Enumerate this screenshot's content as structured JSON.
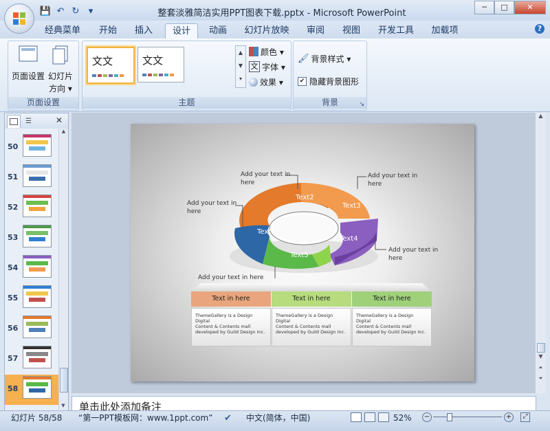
{
  "window": {
    "title": "整套淡雅简洁实用PPT图表下载.pptx - Microsoft PowerPoint",
    "min": "─",
    "max": "□",
    "close": "✕"
  },
  "qat": {
    "save": "💾",
    "undo": "↶",
    "redo": "↻",
    "more": "▾"
  },
  "tabs": [
    "经典菜单",
    "开始",
    "插入",
    "设计",
    "动画",
    "幻灯片放映",
    "审阅",
    "视图",
    "开发工具",
    "加载项"
  ],
  "active_tab": "设计",
  "help": "?",
  "ribbon": {
    "page_setup": {
      "btn1": "页面设置",
      "btn2_line1": "幻灯片",
      "btn2_line2": "方向 ▾",
      "label": "页面设置"
    },
    "themes": {
      "thumb1_text": "文文",
      "thumb2_text": "文文",
      "colors": "颜色 ▾",
      "fonts": "字体 ▾",
      "effects": "效果 ▾",
      "font_glyph": "文",
      "label": "主题"
    },
    "background": {
      "styles": "背景样式 ▾",
      "hide": "隐藏背景图形",
      "label": "背景",
      "launcher": "↘"
    }
  },
  "slides": [
    {
      "num": "50"
    },
    {
      "num": "51"
    },
    {
      "num": "52"
    },
    {
      "num": "53"
    },
    {
      "num": "54"
    },
    {
      "num": "55"
    },
    {
      "num": "56"
    },
    {
      "num": "57"
    },
    {
      "num": "58"
    }
  ],
  "pane_close": "✕",
  "slide_content": {
    "segments": [
      "Text1",
      "Text2",
      "Text3",
      "Text4",
      "Text5"
    ],
    "callouts": {
      "left_line1": "Add your text in",
      "left_line2": "here",
      "top_line1": "Add your text in",
      "top_line2": "here",
      "topright_line1": "Add your text in",
      "topright_line2": "here",
      "right_line1": "Add your text in",
      "right_line2": "here",
      "bottom": "Add your text in here"
    },
    "table": {
      "headers": [
        "Text in here",
        "Text in here",
        "Text in here"
      ],
      "header_colors": [
        "#e9a57d",
        "#b6dc7e",
        "#9fd07a"
      ],
      "body_line1": "ThemeGallery is a Design Digital",
      "body_line2": "Content & Contents mall",
      "body_line3": "developed by Guild Design Inc."
    },
    "segment_colors": {
      "Text1": "#2e67a6",
      "Text2": "#e37a2c",
      "Text3": "#f29a4e",
      "Text4": "#8a5fbf",
      "Text5": "#5bb94a"
    }
  },
  "notes_placeholder": "单击此处添加备注",
  "status": {
    "slide": "幻灯片 58/58",
    "theme": "“第一PPT模板网：www.1ppt.com”",
    "lang": "中文(简体，中国)",
    "zoom": "52%"
  }
}
